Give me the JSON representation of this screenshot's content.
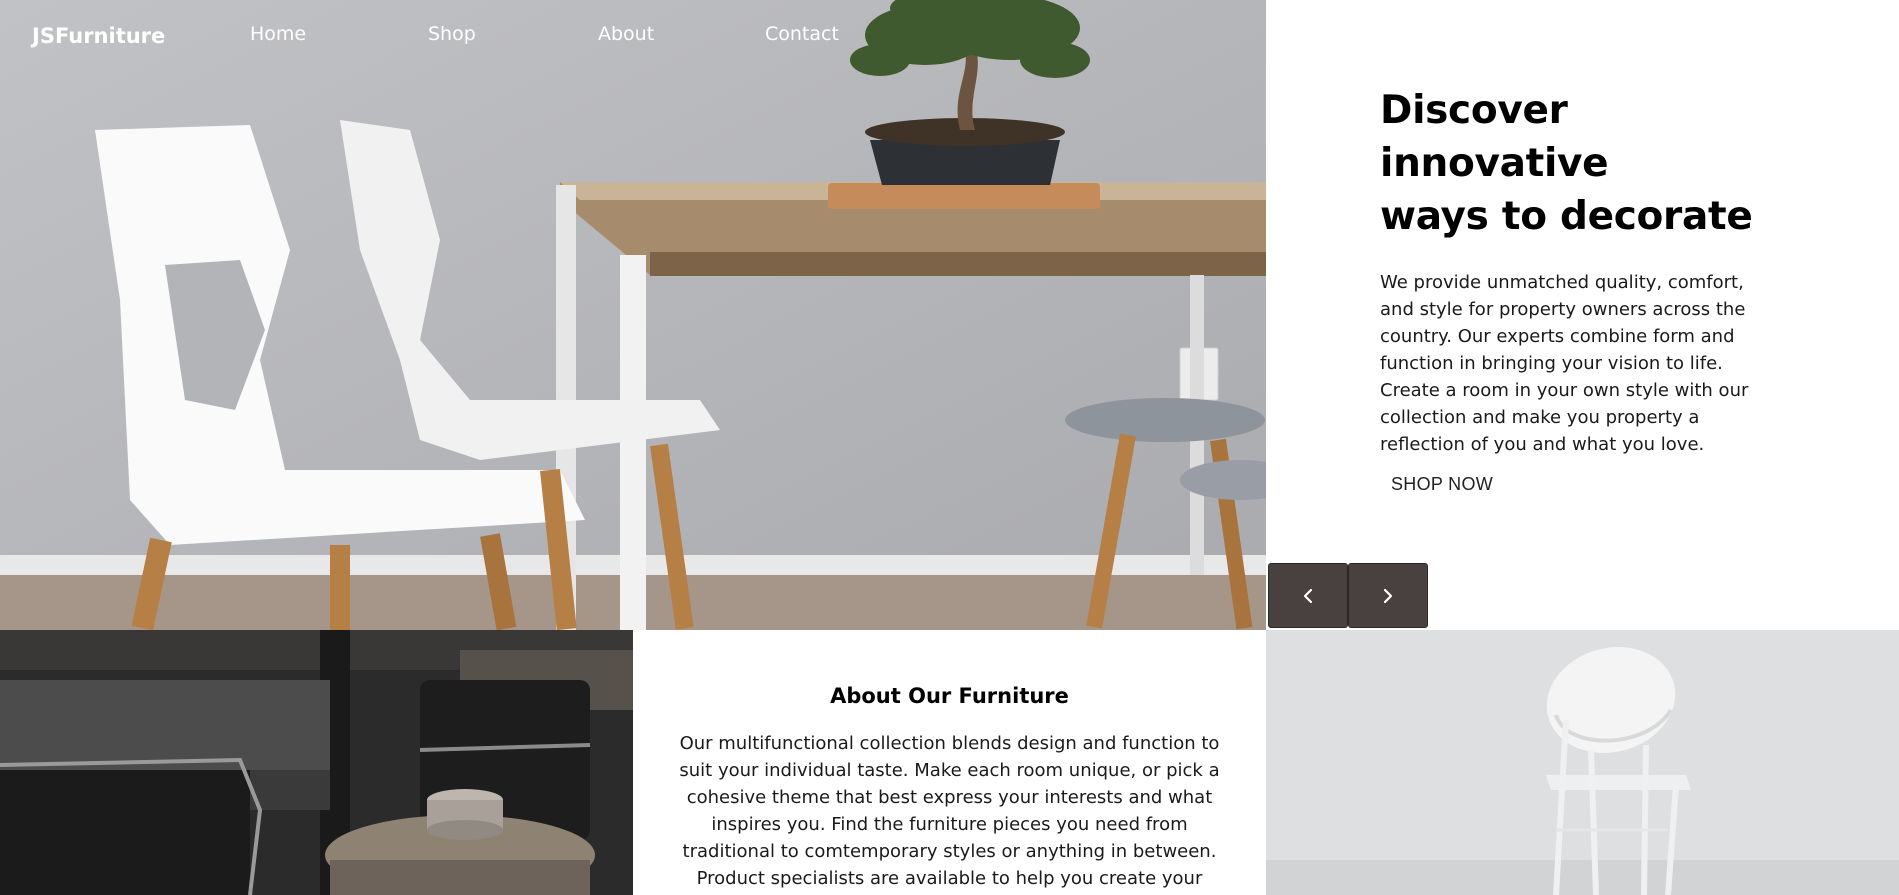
{
  "nav": {
    "logo": "JSFurniture",
    "links": [
      "Home",
      "Shop",
      "About",
      "Contact"
    ]
  },
  "hero": {
    "title_line1": "Discover innovative",
    "title_line2": "ways to decorate",
    "description": "We provide unmatched quality, comfort, and style for property owners across the country. Our experts combine form and function in bringing your vision to life. Create a room in your own style with our collection and make you property a reflection of you and what you love.",
    "cta": "SHOP NOW",
    "prev_icon": "chevron-left-icon",
    "next_icon": "chevron-right-icon"
  },
  "about": {
    "title": "About Our Furniture",
    "description": "Our multifunctional collection blends design and function to suit your individual taste. Make each room unique, or pick a cohesive theme that best express your interests and what inspires you. Find the furniture pieces you need from traditional to comtemporary styles or anything in between. Product specialists are available to help you create your dream space."
  },
  "colors": {
    "arrow_button_bg": "#48413f",
    "text": "#111111",
    "background": "#ffffff"
  }
}
